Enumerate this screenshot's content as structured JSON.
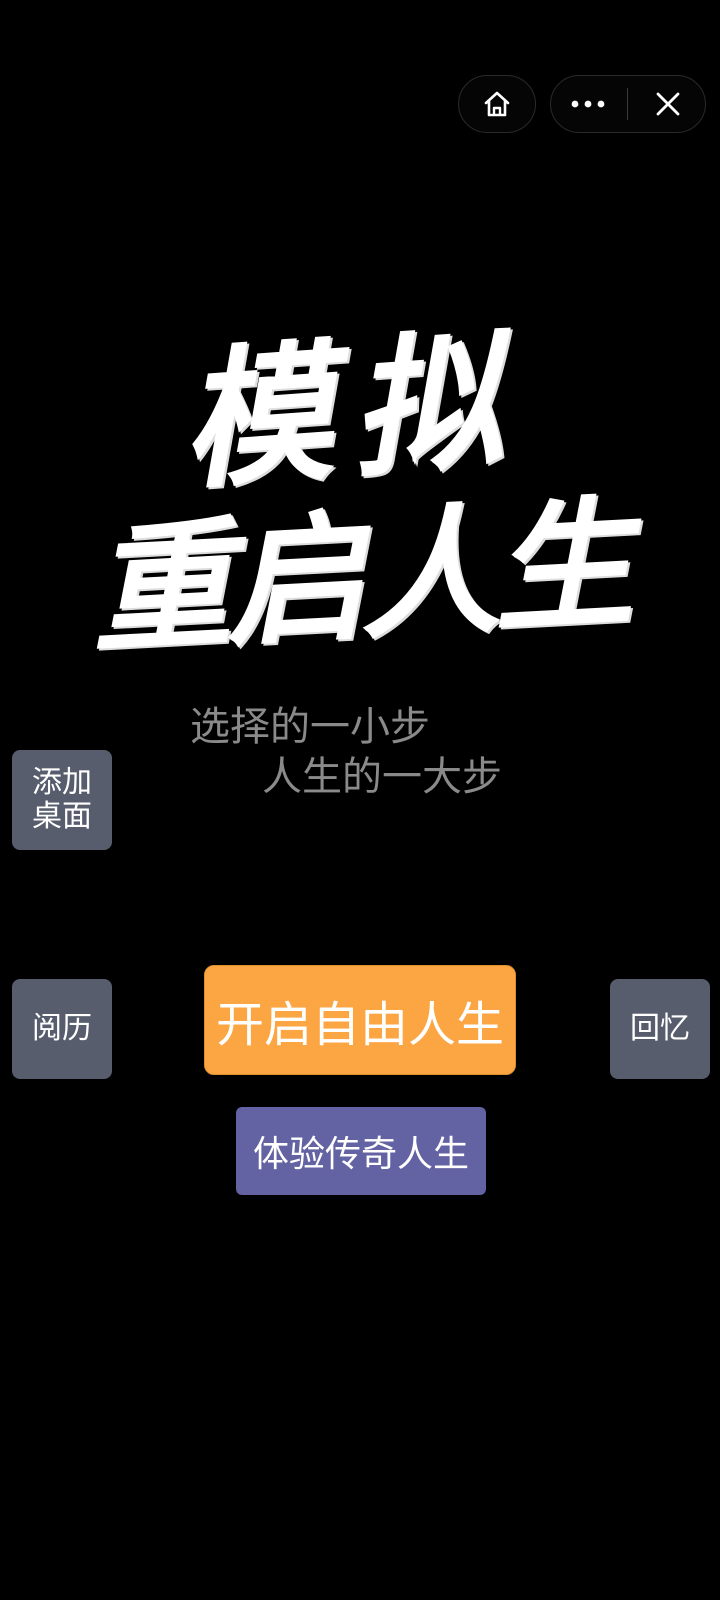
{
  "capsule": {
    "home_icon": "home-icon",
    "more_icon": "more-dots-icon",
    "close_icon": "close-icon"
  },
  "title": {
    "line1": "模拟",
    "line2": "重启人生"
  },
  "tagline": {
    "line1": "选择的一小步",
    "line2": "人生的一大步"
  },
  "buttons": {
    "add_desktop": "添加桌面",
    "history": "阅历",
    "memory": "回忆",
    "free_life": "开启自由人生",
    "legend_life": "体验传奇人生"
  },
  "colors": {
    "background": "#000000",
    "side_button": "#575d6c",
    "primary_button": "#fba642",
    "secondary_button": "#6362a2",
    "tagline": "#8a8a8a"
  }
}
